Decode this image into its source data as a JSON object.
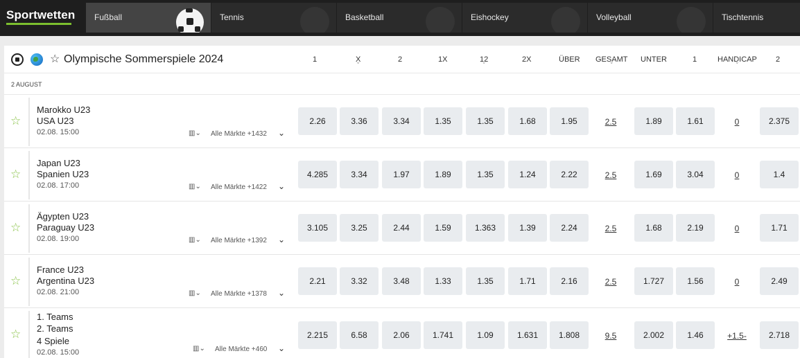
{
  "brand": "Sportwetten",
  "sports": [
    "Fußball",
    "Tennis",
    "Basketball",
    "Eishockey",
    "Volleyball",
    "Tischtennis"
  ],
  "league": {
    "title": "Olympische Sommerspiele 2024",
    "columns": [
      "1",
      "X",
      "2",
      "1X",
      "12",
      "2X",
      "ÜBER",
      "GESAMT",
      "UNTER",
      "1",
      "HANDICAP",
      "2"
    ]
  },
  "date": "2 AUGUST",
  "matches": [
    {
      "team1": "Marokko U23",
      "team2": "USA U23",
      "time": "02.08. 15:00",
      "markets": "Alle Märkte +1432",
      "odds": [
        "2.26",
        "3.36",
        "3.34",
        "1.35",
        "1.35",
        "1.68",
        "1.95"
      ],
      "total": "2.5",
      "under": "1.89",
      "h1": "1.61",
      "handicap": "0",
      "h2": "2.375"
    },
    {
      "team1": "Japan U23",
      "team2": "Spanien U23",
      "time": "02.08. 17:00",
      "markets": "Alle Märkte +1422",
      "odds": [
        "4.285",
        "3.34",
        "1.97",
        "1.89",
        "1.35",
        "1.24",
        "2.22"
      ],
      "total": "2.5",
      "under": "1.69",
      "h1": "3.04",
      "handicap": "0",
      "h2": "1.4"
    },
    {
      "team1": "Ägypten U23",
      "team2": "Paraguay U23",
      "time": "02.08. 19:00",
      "markets": "Alle Märkte +1392",
      "odds": [
        "3.105",
        "3.25",
        "2.44",
        "1.59",
        "1.363",
        "1.39",
        "2.24"
      ],
      "total": "2.5",
      "under": "1.68",
      "h1": "2.19",
      "handicap": "0",
      "h2": "1.71"
    },
    {
      "team1": "France U23",
      "team2": "Argentina U23",
      "time": "02.08. 21:00",
      "markets": "Alle Märkte +1378",
      "odds": [
        "2.21",
        "3.32",
        "3.48",
        "1.33",
        "1.35",
        "1.71",
        "2.16"
      ],
      "total": "2.5",
      "under": "1.727",
      "h1": "1.56",
      "handicap": "0",
      "h2": "2.49"
    },
    {
      "team1": "1. Teams",
      "team2": "2. Teams",
      "team3": "4 Spiele",
      "time": "02.08. 15:00",
      "markets": "Alle Märkte +460",
      "odds": [
        "2.215",
        "6.58",
        "2.06",
        "1.741",
        "1.09",
        "1.631",
        "1.808"
      ],
      "total": "9.5",
      "under": "2.002",
      "h1": "1.46",
      "handicap": "+1.5-",
      "h2": "2.718"
    }
  ]
}
